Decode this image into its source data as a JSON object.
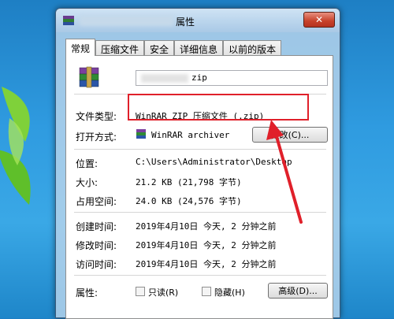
{
  "window": {
    "title_suffix": "属性",
    "close_glyph": "✕"
  },
  "tabs": [
    {
      "label": "常规",
      "active": true
    },
    {
      "label": "压缩文件"
    },
    {
      "label": "安全"
    },
    {
      "label": "详细信息"
    },
    {
      "label": "以前的版本"
    }
  ],
  "general": {
    "file_name_ext": "zip",
    "file_type_label": "文件类型:",
    "file_type_value": "WinRAR ZIP 压缩文件 (.zip)",
    "open_with_label": "打开方式:",
    "open_with_value": "WinRAR archiver",
    "change_button": "更改(C)...",
    "location_label": "位置:",
    "location_value": "C:\\Users\\Administrator\\Desktop",
    "size_label": "大小:",
    "size_value": "21.2 KB (21,798 字节)",
    "size_on_disk_label": "占用空间:",
    "size_on_disk_value": "24.0 KB (24,576 字节)",
    "created_label": "创建时间:",
    "created_value": "2019年4月10日 今天, 2 分钟之前",
    "modified_label": "修改时间:",
    "modified_value": "2019年4月10日 今天, 2 分钟之前",
    "accessed_label": "访问时间:",
    "accessed_value": "2019年4月10日 今天, 2 分钟之前",
    "attributes_label": "属性:",
    "readonly_label": "只读(R)",
    "hidden_label": "隐藏(H)",
    "advanced_button": "高级(D)..."
  },
  "colors": {
    "highlight": "#e0202a",
    "desktop": "#2f9be0"
  }
}
